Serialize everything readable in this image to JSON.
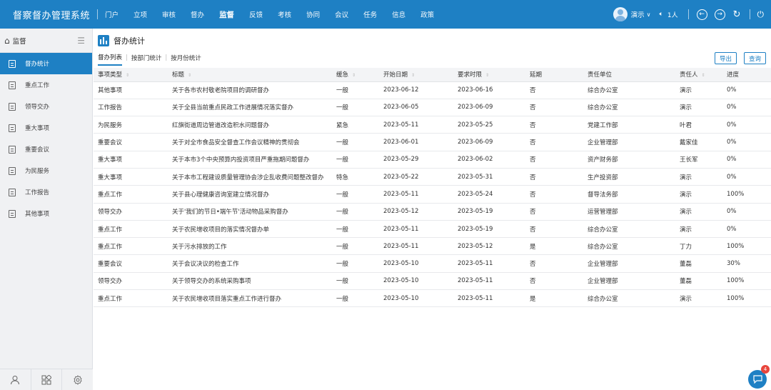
{
  "app": {
    "title": "督察督办管理系统"
  },
  "nav": [
    {
      "label": "门户",
      "active": false
    },
    {
      "label": "立项",
      "active": false
    },
    {
      "label": "审核",
      "active": false
    },
    {
      "label": "督办",
      "active": false
    },
    {
      "label": "监督",
      "active": true
    },
    {
      "label": "反馈",
      "active": false
    },
    {
      "label": "考核",
      "active": false
    },
    {
      "label": "协同",
      "active": false
    },
    {
      "label": "会议",
      "active": false
    },
    {
      "label": "任务",
      "active": false
    },
    {
      "label": "信息",
      "active": false
    },
    {
      "label": "政策",
      "active": false
    }
  ],
  "user": {
    "name": "演示",
    "online_label": "1人"
  },
  "icons": {
    "volume": "volume-icon",
    "back": "circle-arrow-left-icon",
    "forward": "circle-arrow-right-icon",
    "refresh": "refresh-icon",
    "power": "power-icon",
    "home": "home-icon",
    "menu": "hamburger-menu-icon",
    "doc": "document-icon",
    "chart": "bar-chart-icon",
    "chat": "chat-bubble-icon"
  },
  "colors": {
    "brand": "#1e80c4",
    "badge": "#e8453c"
  },
  "sidebar": {
    "title": "监督",
    "items": [
      {
        "label": "督办统计",
        "active": true
      },
      {
        "label": "重点工作",
        "active": false
      },
      {
        "label": "领导交办",
        "active": false
      },
      {
        "label": "重大事项",
        "active": false
      },
      {
        "label": "重要会议",
        "active": false
      },
      {
        "label": "为民服务",
        "active": false
      },
      {
        "label": "工作报告",
        "active": false
      },
      {
        "label": "其他事项",
        "active": false
      }
    ]
  },
  "page": {
    "title": "督办统计",
    "tabs": [
      {
        "label": "督办列表",
        "active": true
      },
      {
        "label": "按部门统计",
        "active": false
      },
      {
        "label": "按月份统计",
        "active": false
      }
    ],
    "export_label": "导出",
    "query_label": "查询"
  },
  "table": {
    "columns": [
      "事项类型",
      "标题",
      "缓急",
      "开始日期",
      "要求时限",
      "延期",
      "责任单位",
      "责任人",
      "进度"
    ],
    "sortable": [
      true,
      true,
      true,
      true,
      true,
      false,
      false,
      true,
      false
    ],
    "rows": [
      [
        "其他事项",
        "关于各市农村敬老院项目的调研督办",
        "一般",
        "2023-06-12",
        "2023-06-16",
        "否",
        "综合办公室",
        "演示",
        "0%"
      ],
      [
        "工作报告",
        "关于全县当前重点民政工作进展情况落实督办",
        "一般",
        "2023-06-05",
        "2023-06-09",
        "否",
        "综合办公室",
        "演示",
        "0%"
      ],
      [
        "为民服务",
        "红旗街道周边管道改造积水问题督办",
        "紧急",
        "2023-05-11",
        "2023-05-25",
        "否",
        "党建工作部",
        "叶君",
        "0%"
      ],
      [
        "重要会议",
        "关于对全市食品安全督查工作会议精神的贯彻会",
        "一般",
        "2023-06-01",
        "2023-06-09",
        "否",
        "企业管理部",
        "戴家佳",
        "0%"
      ],
      [
        "重大事项",
        "关于本市3个中央预算内投资项目严重拖期问题督办",
        "一般",
        "2023-05-29",
        "2023-06-02",
        "否",
        "资产财务部",
        "王长军",
        "0%"
      ],
      [
        "重大事项",
        "关于本市工程建设质量管理协会涉企乱收费问题整改督办",
        "特急",
        "2023-05-22",
        "2023-05-31",
        "否",
        "生产投资部",
        "演示",
        "0%"
      ],
      [
        "重点工作",
        "关于县心理健康咨询室建立情况督办",
        "一般",
        "2023-05-11",
        "2023-05-24",
        "否",
        "督导法务部",
        "演示",
        "100%"
      ],
      [
        "领导交办",
        "关于'我们的节日•端午节'活动物品采购督办",
        "一般",
        "2023-05-12",
        "2023-05-19",
        "否",
        "运营管理部",
        "演示",
        "0%"
      ],
      [
        "重点工作",
        "关于农民增收项目的落实情况督办单",
        "一般",
        "2023-05-11",
        "2023-05-19",
        "否",
        "综合办公室",
        "演示",
        "0%"
      ],
      [
        "重点工作",
        "关于污水排放的工作",
        "一般",
        "2023-05-11",
        "2023-05-12",
        "是",
        "综合办公室",
        "丁力",
        "100%"
      ],
      [
        "重要会议",
        "关于会议决议的检查工作",
        "一般",
        "2023-05-10",
        "2023-05-11",
        "否",
        "企业管理部",
        "董磊",
        "30%"
      ],
      [
        "领导交办",
        "关于领导交办的系统采购事项",
        "一般",
        "2023-05-10",
        "2023-05-11",
        "否",
        "企业管理部",
        "董磊",
        "100%"
      ],
      [
        "重点工作",
        "关于农民增收项目落实重点工作进行督办",
        "一般",
        "2023-05-10",
        "2023-05-11",
        "是",
        "综合办公室",
        "演示",
        "100%"
      ]
    ]
  },
  "notifications": {
    "count": "4"
  }
}
